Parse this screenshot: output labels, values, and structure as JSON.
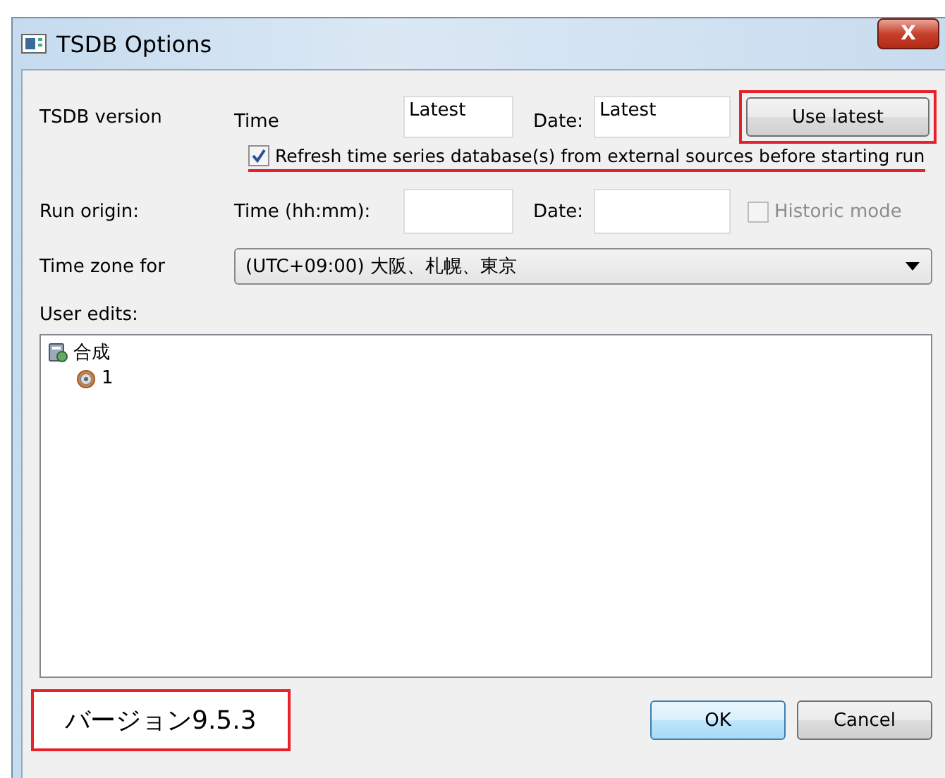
{
  "window": {
    "title": "TSDB Options",
    "close": "X"
  },
  "tsdb_version": {
    "label": "TSDB version",
    "time_label": "Time",
    "time_value": "Latest",
    "date_label": "Date:",
    "date_value": "Latest",
    "button": {
      "label": "Use latest",
      "highlighted": true
    }
  },
  "refresh": {
    "label": "Refresh time series database(s) from external sources before starting run",
    "checked": true,
    "underlined": true
  },
  "run_origin": {
    "label": "Run origin:",
    "time_label": "Time (hh:mm):",
    "date_label": "Date:",
    "historic": {
      "label": "Historic mode",
      "checked": false,
      "disabled": true
    }
  },
  "time_zone": {
    "label": "Time zone for",
    "value": "(UTC+09:00) 大阪、札幌、東京"
  },
  "user_edits": {
    "label": "User edits:",
    "tree": [
      {
        "label": "合成",
        "kind": "group",
        "children": [
          {
            "label": "1",
            "kind": "item"
          }
        ]
      }
    ]
  },
  "version_note": "バージョン9.5.3",
  "buttons": [
    {
      "label": "OK",
      "kind": "default"
    },
    {
      "label": "Cancel",
      "kind": "normal"
    }
  ]
}
